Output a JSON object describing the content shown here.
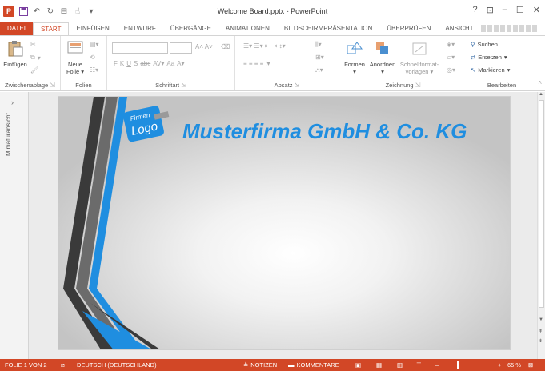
{
  "window": {
    "title": "Welcome Board.pptx - PowerPoint",
    "controls": [
      "?",
      "⊡",
      "–",
      "☐",
      "✕"
    ]
  },
  "tabs": [
    "DATEI",
    "START",
    "EINFÜGEN",
    "ENTWURF",
    "ÜBERGÄNGE",
    "ANIMATIONEN",
    "BILDSCHIRMPRÄSENTATION",
    "ÜBERPRÜFEN",
    "ANSICHT"
  ],
  "active_tab": "START",
  "ribbon": {
    "zwischenablage": {
      "label": "Zwischenablage",
      "paste": "Einfügen"
    },
    "folien": {
      "label": "Folien",
      "new_slide_1": "Neue",
      "new_slide_2": "Folie"
    },
    "schriftart": {
      "label": "Schriftart",
      "bold": "F",
      "italic": "K",
      "underline": "U",
      "shadow": "S",
      "strike": "abc",
      "case": "Aa"
    },
    "absatz": {
      "label": "Absatz"
    },
    "zeichnung": {
      "label": "Zeichnung",
      "formen": "Formen",
      "anordnen": "Anordnen",
      "schnell_1": "Schnellformat-",
      "schnell_2": "vorlagen"
    },
    "bearbeiten": {
      "label": "Bearbeiten",
      "suchen": "Suchen",
      "ersetzen": "Ersetzen",
      "markieren": "Markieren"
    }
  },
  "sidepanel": {
    "label": "Miniaturansicht"
  },
  "slide": {
    "logo_line1": "Firmen",
    "logo_line2": "Logo",
    "company": "Musterfirma GmbH & Co. KG",
    "accent": "#1f8ee0"
  },
  "status": {
    "slide": "FOLIE 1 VON 2",
    "language": "DEUTSCH (DEUTSCHLAND)",
    "notes": "NOTIZEN",
    "comments": "KOMMENTARE",
    "zoom_minus": "–",
    "zoom_plus": "+",
    "zoom": "65 %",
    "zoom_value": 65
  },
  "colors": {
    "accent": "#d24726",
    "slide_blue": "#1f8ee0"
  }
}
